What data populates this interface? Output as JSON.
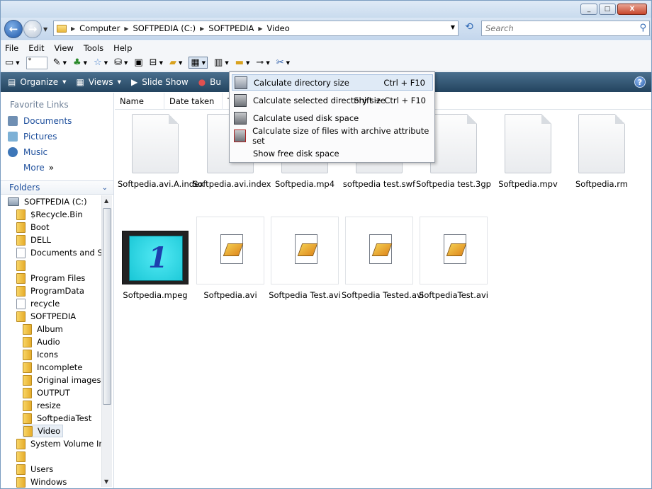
{
  "window": {
    "buttons": [
      "_",
      "□",
      "X"
    ]
  },
  "address": {
    "crumbs": [
      "Computer",
      "SOFTPEDIA (C:)",
      "SOFTPEDIA",
      "Video"
    ],
    "search_placeholder": "Search"
  },
  "menubar": [
    "File",
    "Edit",
    "View",
    "Tools",
    "Help"
  ],
  "toolbar": {
    "box_text": "*"
  },
  "commandbar": {
    "items": [
      "Organize",
      "Views",
      "Slide Show",
      "Bu"
    ],
    "help": "?"
  },
  "nav": {
    "favorites_title": "Favorite Links",
    "favorites": [
      "Documents",
      "Pictures",
      "Music",
      "More"
    ],
    "more_arrow": "»",
    "folders_title": "Folders",
    "tree": [
      {
        "label": "SOFTPEDIA (C:)",
        "indent": 0,
        "type": "drive"
      },
      {
        "label": "$Recycle.Bin",
        "indent": 1,
        "type": "folder"
      },
      {
        "label": "Boot",
        "indent": 1,
        "type": "folder"
      },
      {
        "label": "DELL",
        "indent": 1,
        "type": "folder"
      },
      {
        "label": "Documents and Sett",
        "indent": 1,
        "type": "shortcut"
      },
      {
        "label": "",
        "indent": 1,
        "type": "folder"
      },
      {
        "label": "Program Files",
        "indent": 1,
        "type": "folder"
      },
      {
        "label": "ProgramData",
        "indent": 1,
        "type": "folder"
      },
      {
        "label": "recycle",
        "indent": 1,
        "type": "doc"
      },
      {
        "label": "SOFTPEDIA",
        "indent": 1,
        "type": "folder"
      },
      {
        "label": "Album",
        "indent": 2,
        "type": "folder"
      },
      {
        "label": "Audio",
        "indent": 2,
        "type": "folder"
      },
      {
        "label": "Icons",
        "indent": 2,
        "type": "folder"
      },
      {
        "label": "Incomplete",
        "indent": 2,
        "type": "folder"
      },
      {
        "label": "Original images",
        "indent": 2,
        "type": "folder"
      },
      {
        "label": "OUTPUT",
        "indent": 2,
        "type": "folder"
      },
      {
        "label": "resize",
        "indent": 2,
        "type": "folder"
      },
      {
        "label": "SoftpediaTest",
        "indent": 2,
        "type": "folder"
      },
      {
        "label": "Video",
        "indent": 2,
        "type": "folder",
        "selected": true
      },
      {
        "label": "System Volume Inforr",
        "indent": 1,
        "type": "folder"
      },
      {
        "label": "",
        "indent": 1,
        "type": "folder"
      },
      {
        "label": "Users",
        "indent": 1,
        "type": "folder"
      },
      {
        "label": "Windows",
        "indent": 1,
        "type": "folder"
      }
    ]
  },
  "columns": [
    "Name",
    "Date taken",
    "T"
  ],
  "files_row1": [
    "Softpedia.avi.A.index",
    "Softpedia.avi.index",
    "Softpedia.mp4",
    "softpedia test.swf",
    "Softpedia test.3gp",
    "Softpedia.mpv",
    "Softpedia.rm"
  ],
  "files_row2": [
    "Softpedia.mpeg",
    "Softpedia.avi",
    "Softpedia Test.avi",
    "Softpedia Tested.avi",
    "SoftpediaTest.avi"
  ],
  "dropdown": [
    {
      "label": "Calculate directory size",
      "shortcut": "Ctrl + F10"
    },
    {
      "label": "Calculate selected directory size",
      "shortcut": "Shift + Ctrl + F10"
    },
    {
      "label": "Calculate used disk space",
      "shortcut": ""
    },
    {
      "label": "Calculate size of files with archive attribute set",
      "shortcut": ""
    },
    {
      "label": "Show free disk space",
      "shortcut": ""
    }
  ]
}
